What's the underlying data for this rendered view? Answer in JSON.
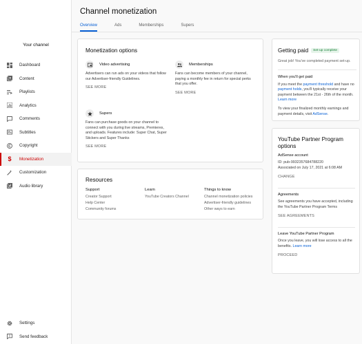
{
  "sidebar": {
    "channel_label": "Your channel",
    "items": [
      {
        "label": "Dashboard",
        "icon": "dashboard-icon"
      },
      {
        "label": "Content",
        "icon": "content-icon"
      },
      {
        "label": "Playlists",
        "icon": "playlists-icon"
      },
      {
        "label": "Analytics",
        "icon": "analytics-icon"
      },
      {
        "label": "Comments",
        "icon": "comments-icon"
      },
      {
        "label": "Subtitles",
        "icon": "subtitles-icon"
      },
      {
        "label": "Copyright",
        "icon": "copyright-icon"
      },
      {
        "label": "Monetization",
        "icon": "dollar-icon",
        "active": true
      },
      {
        "label": "Customization",
        "icon": "customization-icon"
      },
      {
        "label": "Audio library",
        "icon": "audio-library-icon"
      }
    ],
    "bottom": [
      {
        "label": "Settings",
        "icon": "gear-icon"
      },
      {
        "label": "Send feedback",
        "icon": "feedback-icon"
      }
    ]
  },
  "header": {
    "title": "Channel monetization",
    "tabs": [
      "Overview",
      "Ads",
      "Memberships",
      "Supers"
    ]
  },
  "monetization": {
    "title": "Monetization options",
    "video_ads": {
      "title": "Video advertising",
      "desc": "Advertisers can run ads on your videos that follow our Advertiser-friendly Guidelines.",
      "action": "SEE MORE"
    },
    "memberships": {
      "title": "Memberships",
      "desc": "Fans can become members of your channel, paying a monthly fee in return for special perks that you offer.",
      "action": "SEE MORE"
    },
    "supers": {
      "title": "Supers",
      "desc": "Fans can purchase goods on your channel to connect with you during live streams, Premieres, and uploads. Features include: Super Chat, Super Stickers and Super Thanks",
      "action": "SEE MORE"
    }
  },
  "resources": {
    "title": "Resources",
    "columns": [
      {
        "title": "Support",
        "links": [
          "Creator Support",
          "Help Center",
          "Community forums"
        ]
      },
      {
        "title": "Learn",
        "links": [
          "YouTube Creators Channel"
        ]
      },
      {
        "title": "Things to know",
        "links": [
          "Channel monetization policies",
          "Advertiser-friendly guidelines",
          "Other ways to earn"
        ]
      }
    ]
  },
  "getting_paid": {
    "title": "Getting paid",
    "badge": "Set-up complete",
    "status": "Great job! You've completed payment set-up.",
    "when_title": "When you'll get paid",
    "when_p1": "If you meet the ",
    "when_link1": "payment threshold",
    "when_p2": " and have no ",
    "when_link2": "payment holds",
    "when_p3": ", you'll typically receive your payment between the 21st - 26th of the month. ",
    "when_link3": "Learn more",
    "view_p1": "To view your finalized monthly earnings and payment details, visit ",
    "view_link": "AdSense",
    "view_p2": "."
  },
  "ypp": {
    "title": "YouTube Partner Program options",
    "adsense_title": "AdSense account",
    "adsense_id": "ID: pub-9932357684788220",
    "adsense_assoc": "Associated on July 17, 2021 at 6:08 AM",
    "adsense_action": "CHANGE",
    "agreements_title": "Agreements",
    "agreements_desc": "See agreements you have accepted, including the YouTube Partner Program Terms",
    "agreements_action": "SEE AGREEMENTS",
    "leave_title": "Leave YouTube Partner Program",
    "leave_desc": "Once you leave, you will lose access to all the benefits. ",
    "leave_link": "Learn more",
    "leave_action": "PROCEED"
  },
  "colors": {
    "accent": "#065fd4",
    "active": "#cc0000",
    "badge_bg": "#e6f4ea",
    "badge_fg": "#188038"
  }
}
